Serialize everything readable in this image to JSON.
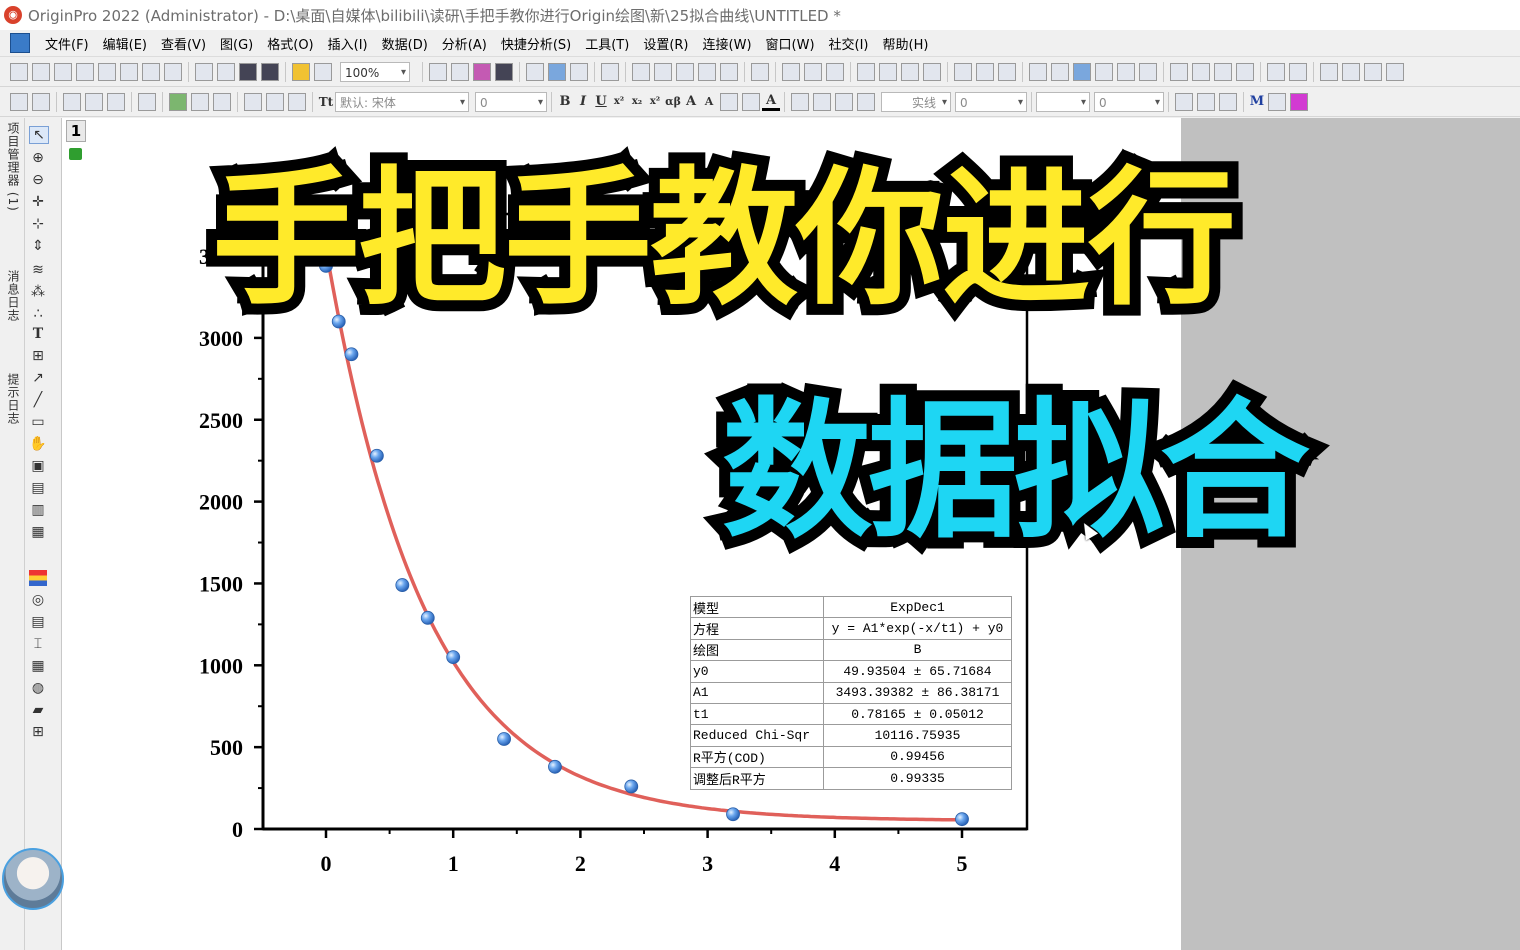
{
  "window": {
    "title": "OriginPro 2022 (Administrator) - D:\\桌面\\自媒体\\bilibili\\读研\\手把手教你进行Origin绘图\\新\\25拟合曲线\\UNTITLED *"
  },
  "menu": {
    "items": [
      "文件(F)",
      "编辑(E)",
      "查看(V)",
      "图(G)",
      "格式(O)",
      "插入(I)",
      "数据(D)",
      "分析(A)",
      "快捷分析(S)",
      "工具(T)",
      "设置(R)",
      "连接(W)",
      "窗口(W)",
      "社交(I)",
      "帮助(H)"
    ]
  },
  "toolbar": {
    "zoom": "100%",
    "font": "默认: 宋体",
    "font_size": "0",
    "line_width": "0",
    "line_style": "实线",
    "angle": "0"
  },
  "left_tabs": {
    "project_manager": "项目管理器 (1)",
    "message_log": "消息日志",
    "hint_log": "提示日志"
  },
  "layer": {
    "number": "1"
  },
  "overlay": {
    "line1": "手把手教你进行",
    "line2": "数据拟合"
  },
  "chart_data": {
    "type": "scatter",
    "title": "",
    "xlabel": "",
    "ylabel": "",
    "xlim": [
      -0.5,
      5.5
    ],
    "ylim": [
      0,
      3500
    ],
    "x_ticks": [
      "0",
      "1",
      "2",
      "3",
      "4",
      "5"
    ],
    "y_ticks": [
      "0",
      "500",
      "1000",
      "1500",
      "2000",
      "2500",
      "3000",
      "3500"
    ],
    "series": [
      {
        "name": "B",
        "type": "scatter",
        "color": "#4a8fe0",
        "x": [
          0,
          0.1,
          0.2,
          0.4,
          0.6,
          0.8,
          1.0,
          1.4,
          1.8,
          2.4,
          3.2,
          5.0
        ],
        "y": [
          3440,
          3100,
          2900,
          2280,
          1490,
          1290,
          1050,
          550,
          380,
          260,
          90,
          60
        ]
      },
      {
        "name": "ExpDec1 fit",
        "type": "line",
        "color": "#e0605a",
        "model": {
          "A1": 3493.39382,
          "t1": 0.78165,
          "y0": 49.93504
        }
      }
    ],
    "fit_table": [
      [
        "模型",
        "ExpDec1"
      ],
      [
        "方程",
        "y = A1*exp(-x/t1) + y0"
      ],
      [
        "绘图",
        "B"
      ],
      [
        "y0",
        "49.93504 ± 65.71684"
      ],
      [
        "A1",
        "3493.39382 ± 86.38171"
      ],
      [
        "t1",
        "0.78165 ± 0.05012"
      ],
      [
        "Reduced Chi-Sqr",
        "10116.75935"
      ],
      [
        "R平方(COD)",
        "0.99456"
      ],
      [
        "调整后R平方",
        "0.99335"
      ]
    ]
  }
}
